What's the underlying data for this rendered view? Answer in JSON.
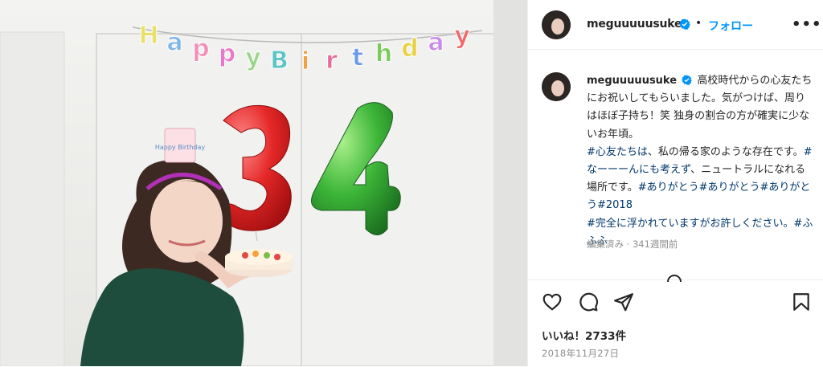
{
  "post": {
    "username": "meguuuuusuke",
    "follow_label": "フォロー",
    "separator": "•",
    "more_label": "•••"
  },
  "photo": {
    "banner": [
      "H",
      "a",
      "p",
      "p",
      "y",
      "B",
      "i",
      "r",
      "t",
      "h",
      "d",
      "a",
      "y"
    ],
    "balloon_left": "3",
    "balloon_right": "4",
    "hat_text": "Happy Birthday"
  },
  "caption": {
    "username": "meguuuuusuke",
    "text_1": "高校時代からの心友たちにお祝いしてもらいました。気がつけば、周りはほぼ子持ち！笑 独身の割合の方が確実に少ないお年頃。",
    "tag_1": "#心友たちは",
    "text_2": "、私の帰る家のような存在です。",
    "tag_2": "#なーーーんにも考えず",
    "text_3": "、ニュートラルになれる場所です。",
    "tag_3": "#ありがとう#ありがとう#ありがとう#2018",
    "tag_4": "#完全に浮かれていますがお許しください。#ふふふ"
  },
  "meta": {
    "edited": "編集済み · 341週間前"
  },
  "engagement": {
    "likes": "いいね！2733件",
    "date": "2018年11月27日"
  },
  "icons": [
    "heart-icon",
    "comment-icon",
    "share-icon",
    "bookmark-icon",
    "verified-badge-icon",
    "more-icon"
  ],
  "colors": {
    "accent": "#0095f6",
    "hashtag": "#00376b",
    "verified": "#0095f6",
    "muted": "#8e8e8e"
  }
}
